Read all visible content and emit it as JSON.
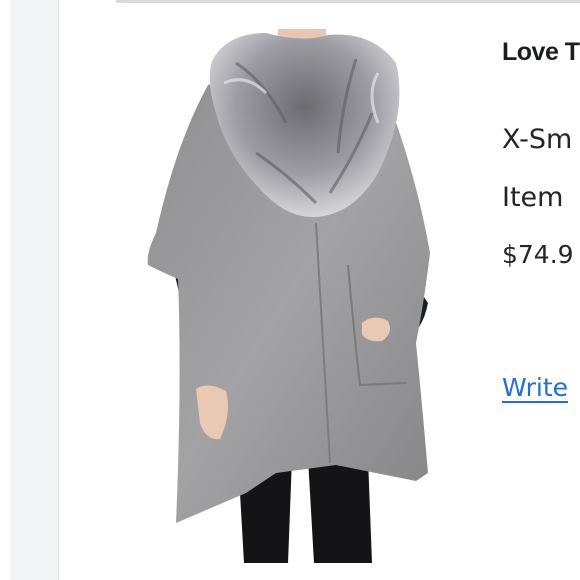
{
  "product": {
    "brand": "Love T",
    "size": "X-Sm",
    "item": "Item",
    "price": "$74.9",
    "review_link": "Write"
  },
  "colors": {
    "link": "#2370d1",
    "text": "#222428",
    "panel": "#f3f4f5"
  }
}
